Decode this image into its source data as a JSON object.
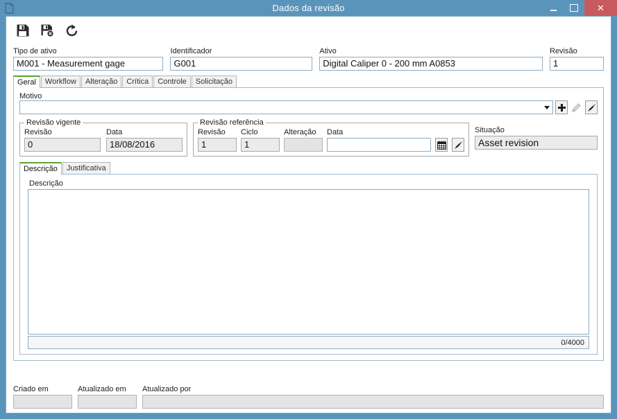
{
  "window": {
    "title": "Dados da revisão",
    "icon": "document-icon",
    "buttons": {
      "minimize": "minimize-icon",
      "maximize": "maximize-icon",
      "close": "✕"
    },
    "accent_color": "#5b94bb",
    "close_color": "#c75a5e"
  },
  "toolbar": {
    "save": "save-icon",
    "save_close": "save-close-icon",
    "refresh": "refresh-icon"
  },
  "header": {
    "asset_type": {
      "label": "Tipo de ativo",
      "value": "M001 - Measurement gage"
    },
    "identifier": {
      "label": "Identificador",
      "value": "G001"
    },
    "asset": {
      "label": "Ativo",
      "value": "Digital Caliper 0 - 200 mm A0853"
    },
    "revision": {
      "label": "Revisão",
      "value": "1"
    }
  },
  "tabs": [
    {
      "label": "Geral",
      "active": true
    },
    {
      "label": "Workflow",
      "active": false
    },
    {
      "label": "Alteração",
      "active": false
    },
    {
      "label": "Crítica",
      "active": false
    },
    {
      "label": "Controle",
      "active": false
    },
    {
      "label": "Solicitação",
      "active": false
    }
  ],
  "motivo": {
    "label": "Motivo",
    "value": "",
    "add_button": "plus-icon",
    "edit_button": "pencil-icon",
    "clear_button": "eraser-icon"
  },
  "current_revision": {
    "legend": "Revisão vigente",
    "revision": {
      "label": "Revisão",
      "value": "0"
    },
    "date": {
      "label": "Data",
      "value": "18/08/2016"
    }
  },
  "reference_revision": {
    "legend": "Revisão referência",
    "revision": {
      "label": "Revisão",
      "value": "1"
    },
    "cycle": {
      "label": "Ciclo",
      "value": "1"
    },
    "change": {
      "label": "Alteração",
      "value": ""
    },
    "date": {
      "label": "Data",
      "value": ""
    },
    "calendar_button": "calendar-icon",
    "clear_button": "eraser-icon"
  },
  "situation": {
    "label": "Situação",
    "value": "Asset revision"
  },
  "desc_tabs": [
    {
      "label": "Descrição",
      "active": true
    },
    {
      "label": "Justificativa",
      "active": false
    }
  ],
  "description": {
    "label": "Descrição",
    "value": "",
    "counter": "0/4000"
  },
  "footer": {
    "created_at": {
      "label": "Criado em",
      "value": ""
    },
    "updated_at": {
      "label": "Atualizado em",
      "value": ""
    },
    "updated_by": {
      "label": "Atualizado por",
      "value": ""
    }
  }
}
